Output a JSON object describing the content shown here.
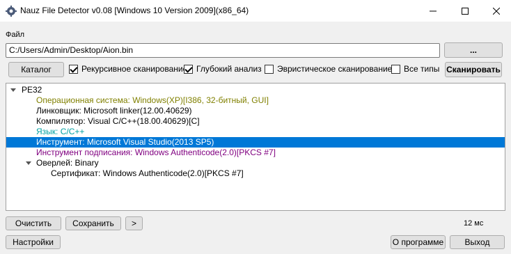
{
  "window": {
    "title": "Nauz File Detector v0.08 [Windows 10 Version 2009](x86_64)",
    "icon": "gear-cog-icon"
  },
  "file": {
    "label": "Файл",
    "path": "C:/Users/Admin/Desktop/Aion.bin",
    "browse_label": "..."
  },
  "options": {
    "catalog_label": "Каталог",
    "recursive": {
      "label": "Рекурсивное сканирование",
      "checked": true
    },
    "deep": {
      "label": "Глубокий анализ",
      "checked": true
    },
    "heuristic": {
      "label": "Эвристическое сканирование",
      "checked": false
    },
    "all_types": {
      "label": "Все типы",
      "checked": false
    },
    "scan_label": "Сканировать"
  },
  "colors": {
    "os": "#808000",
    "language": "#00a0a0",
    "signer": "#800080",
    "selected_bg": "#0078d7"
  },
  "results": {
    "root": "PE32",
    "os": "Операционная система: Windows(XP)[I386, 32-битный, GUI]",
    "linker": "Линковщик: Microsoft linker(12.00.40629)",
    "compiler": "Компилятор: Visual C/C++(18.00.40629)[C]",
    "language": "Язык: C/C++",
    "tool": "Инструмент: Microsoft Visual Studio(2013 SP5)",
    "signer": "Инструмент подписания: Windows Authenticode(2.0)[PKCS #7]",
    "overlay": "Оверлей: Binary",
    "certificate": "Сертификат: Windows Authenticode(2.0)[PKCS #7]"
  },
  "bottom": {
    "clear_label": "Очистить",
    "save_label": "Сохранить",
    "more_label": ">",
    "time": "12 мс",
    "settings_label": "Настройки",
    "about_label": "О программе",
    "exit_label": "Выход"
  }
}
